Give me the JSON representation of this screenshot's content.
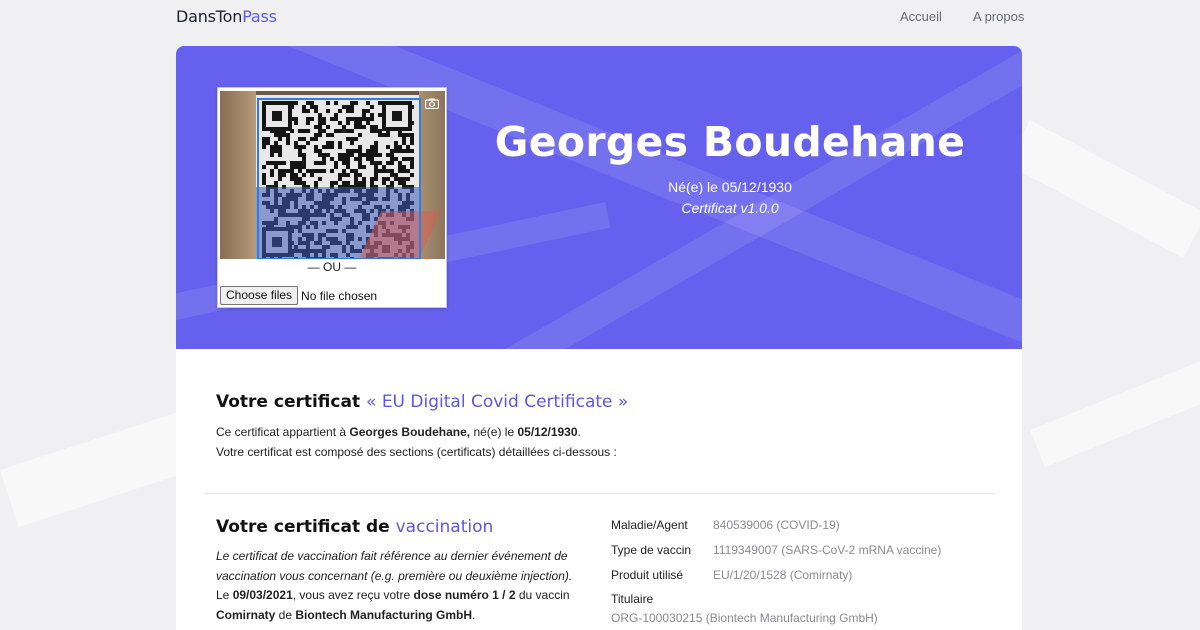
{
  "nav": {
    "brand_part1": "DansTon",
    "brand_part2": "Pass",
    "links": [
      "Accueil",
      "A propos"
    ]
  },
  "scanner": {
    "separator": "— OU —",
    "file_button": "Choose files",
    "file_status": "No file chosen",
    "camera_icon": "camera-icon"
  },
  "hero": {
    "name": "Georges Boudehane",
    "dob_line": "Né(e) le 05/12/1930",
    "version_line": "Certificat v1.0.0"
  },
  "certificate": {
    "heading_prefix": "Votre certificat",
    "heading_accent": "« EU Digital Covid Certificate »",
    "line1_prefix": "Ce certificat appartient à ",
    "line1_name": "Georges Boudehane,",
    "line1_mid": " né(e) le ",
    "line1_date": "05/12/1930",
    "line1_end": ".",
    "line2": "Votre certificat est composé des sections (certificats) détaillées ci-dessous :"
  },
  "vaccination": {
    "heading_prefix": "Votre certificat de",
    "heading_accent": "vaccination",
    "italic_text": "Le certificat de vaccination fait référence au dernier événement de vaccination vous concernant (e.g. première ou deuxième injection).",
    "p2_a": "Le ",
    "p2_date": "09/03/2021",
    "p2_b": ", vous avez reçu votre ",
    "p2_dose": "dose numéro 1 / 2",
    "p2_c": " du vaccin",
    "p3_vaccine": "Comirnaty",
    "p3_a": " de ",
    "p3_maker": "Biontech Manufacturing GmbH",
    "p3_end": ".",
    "details": [
      {
        "key": "Maladie/Agent",
        "value": "840539006 (COVID-19)"
      },
      {
        "key": "Type de vaccin",
        "value": "1119349007 (SARS-CoV-2 mRNA vaccine)"
      },
      {
        "key": "Produit utilisé",
        "value": "EU/1/20/1528 (Comirnaty)"
      }
    ],
    "holder_key": "Titulaire",
    "holder_value": "ORG-100030215 (Biontech Manufacturing GmbH)"
  },
  "colors": {
    "accent": "#5b57e8",
    "hero_bg": "#6561ee",
    "page_bg": "#f0f0f2"
  }
}
